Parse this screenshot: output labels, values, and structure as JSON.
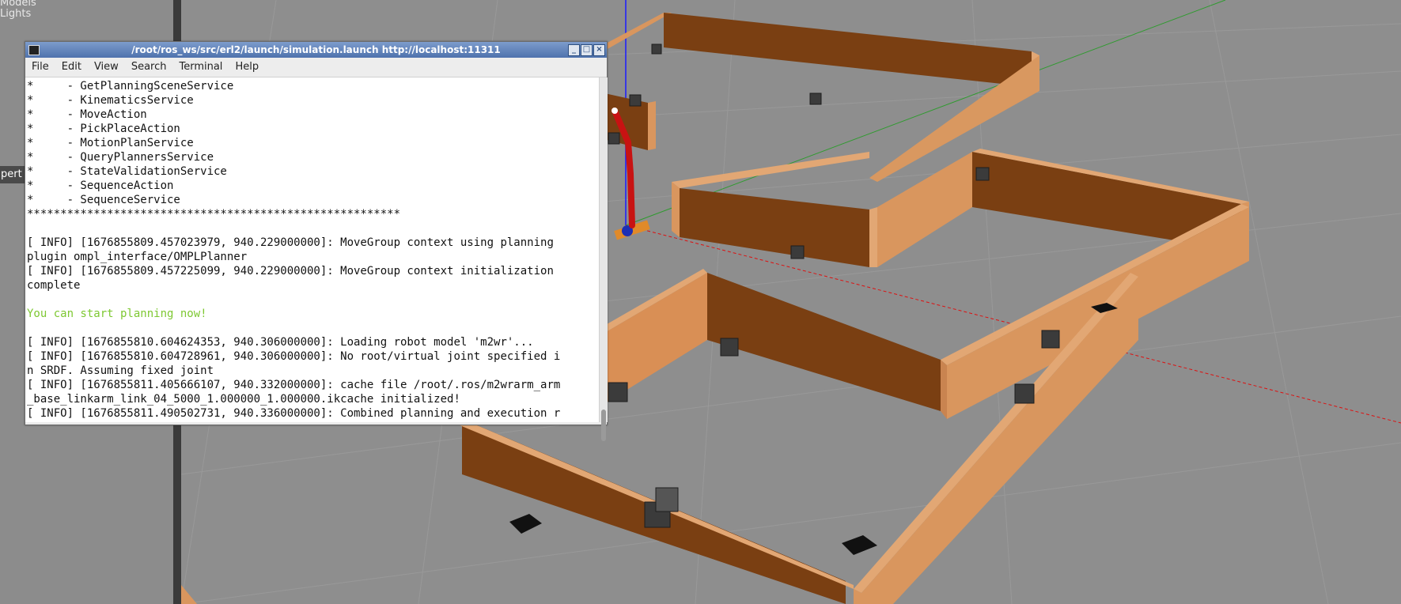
{
  "gazebo": {
    "tree_items": [
      "Models",
      "Lights"
    ],
    "side_tab_label": "pert"
  },
  "terminal": {
    "title": "/root/ros_ws/src/erl2/launch/simulation.launch http://localhost:11311",
    "menu": [
      "File",
      "Edit",
      "View",
      "Search",
      "Terminal",
      "Help"
    ],
    "lines": [
      {
        "text": "*     - GetPlanningSceneService",
        "color": "default"
      },
      {
        "text": "*     - KinematicsService",
        "color": "default"
      },
      {
        "text": "*     - MoveAction",
        "color": "default"
      },
      {
        "text": "*     - PickPlaceAction",
        "color": "default"
      },
      {
        "text": "*     - MotionPlanService",
        "color": "default"
      },
      {
        "text": "*     - QueryPlannersService",
        "color": "default"
      },
      {
        "text": "*     - StateValidationService",
        "color": "default"
      },
      {
        "text": "*     - SequenceAction",
        "color": "default"
      },
      {
        "text": "*     - SequenceService",
        "color": "default"
      },
      {
        "text": "********************************************************",
        "color": "default"
      },
      {
        "text": "",
        "color": "default"
      },
      {
        "text": "[ INFO] [1676855809.457023979, 940.229000000]: MoveGroup context using planning",
        "color": "default"
      },
      {
        "text": "plugin ompl_interface/OMPLPlanner",
        "color": "default"
      },
      {
        "text": "[ INFO] [1676855809.457225099, 940.229000000]: MoveGroup context initialization",
        "color": "default"
      },
      {
        "text": "complete",
        "color": "default"
      },
      {
        "text": "",
        "color": "default"
      },
      {
        "text": "You can start planning now!",
        "color": "green"
      },
      {
        "text": "",
        "color": "default"
      },
      {
        "text": "[ INFO] [1676855810.604624353, 940.306000000]: Loading robot model 'm2wr'...",
        "color": "default"
      },
      {
        "text": "[ INFO] [1676855810.604728961, 940.306000000]: No root/virtual joint specified i",
        "color": "default"
      },
      {
        "text": "n SRDF. Assuming fixed joint",
        "color": "default"
      },
      {
        "text": "[ INFO] [1676855811.405666107, 940.332000000]: cache file /root/.ros/m2wrarm_arm",
        "color": "default"
      },
      {
        "text": "_base_linkarm_link_04_5000_1.000000_1.000000.ikcache initialized!",
        "color": "default"
      },
      {
        "text": "[ INFO] [1676855811.490502731, 940.336000000]: Combined planning and execution r",
        "color": "default"
      }
    ]
  },
  "colors": {
    "ground": "#8f8f8f",
    "wall_light": "#d9965e",
    "wall_dark": "#7a3f12",
    "wall_top": "#e2a774",
    "robot_red": "#d01414",
    "terminal_green": "#7ec832",
    "titlebar": "#5b7fb8"
  },
  "icons": [
    "terminal-app-icon",
    "minimize-icon",
    "maximize-icon",
    "close-icon"
  ]
}
